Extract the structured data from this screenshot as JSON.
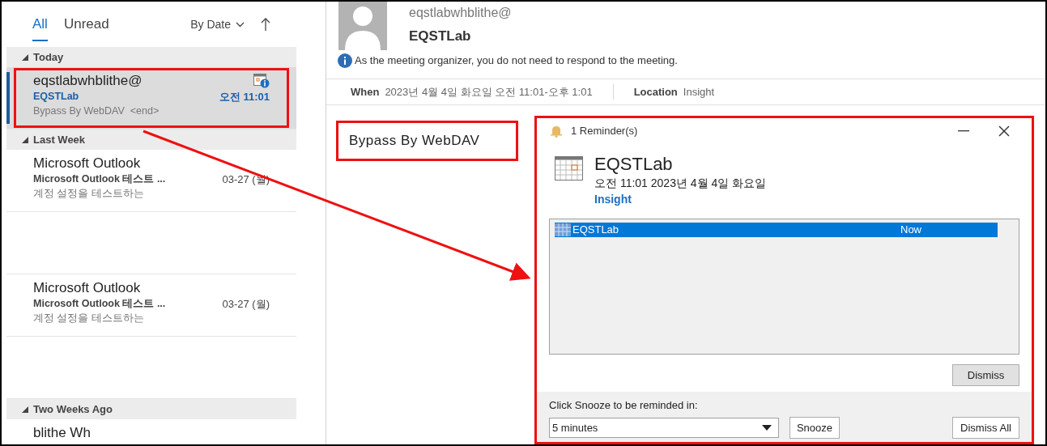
{
  "message_list": {
    "filters": [
      {
        "label": "All",
        "selected": true
      },
      {
        "label": "Unread",
        "selected": false
      }
    ],
    "sort": {
      "label": "By Date"
    },
    "groups": [
      {
        "label": "Today",
        "expanded": true,
        "messages": [
          {
            "kind": "meeting",
            "sender": "eqstlabwhblithe@",
            "subject": "EQSTLab",
            "preview": "Bypass By WebDAV  <end>",
            "time": "오전 11:01",
            "selected": true,
            "unread": true
          }
        ]
      },
      {
        "label": "Last Week",
        "expanded": true,
        "messages": [
          {
            "kind": "mail",
            "sender": "Microsoft Outlook",
            "subject": "Microsoft Outlook 테스트 ...",
            "preview": "계정 설정을 테스트하는",
            "time": "03-27 (월)",
            "selected": false,
            "unread": false
          },
          {
            "kind": "mail",
            "sender": "Microsoft Outlook",
            "subject": "Microsoft Outlook 테스트 ...",
            "preview": "계정 설정을 테스트하는",
            "time": "03-27 (월)",
            "selected": false,
            "unread": false
          }
        ]
      },
      {
        "label": "Two Weeks Ago",
        "expanded": true,
        "messages": [
          {
            "kind": "mail",
            "sender": "blithe Wh",
            "selected": false
          }
        ]
      }
    ]
  },
  "reading_pane": {
    "sender": "eqstlabwhblithe@",
    "subject": "EQSTLab",
    "info": "As the meeting organizer, you do not need to respond to the meeting.",
    "fields": [
      {
        "label": "When",
        "value": "2023년 4월 4일 화요일 오전 11:01-오후 1:01"
      },
      {
        "label": "Location",
        "value": "Insight"
      }
    ],
    "body": "Bypass By WebDAV"
  },
  "reminder": {
    "title": "1 Reminder(s)",
    "subject": "EQSTLab",
    "time": "오전 11:01 2023년 4월 4일 화요일",
    "location": "Insight",
    "items": [
      {
        "subject": "EQSTLab",
        "due": "Now",
        "selected": true
      }
    ],
    "dismiss": "Dismiss",
    "snooze_prompt": "Click Snooze to be reminded in:",
    "snooze_choice": "5 minutes",
    "snooze": "Snooze",
    "dismiss_all": "Dismiss All"
  }
}
